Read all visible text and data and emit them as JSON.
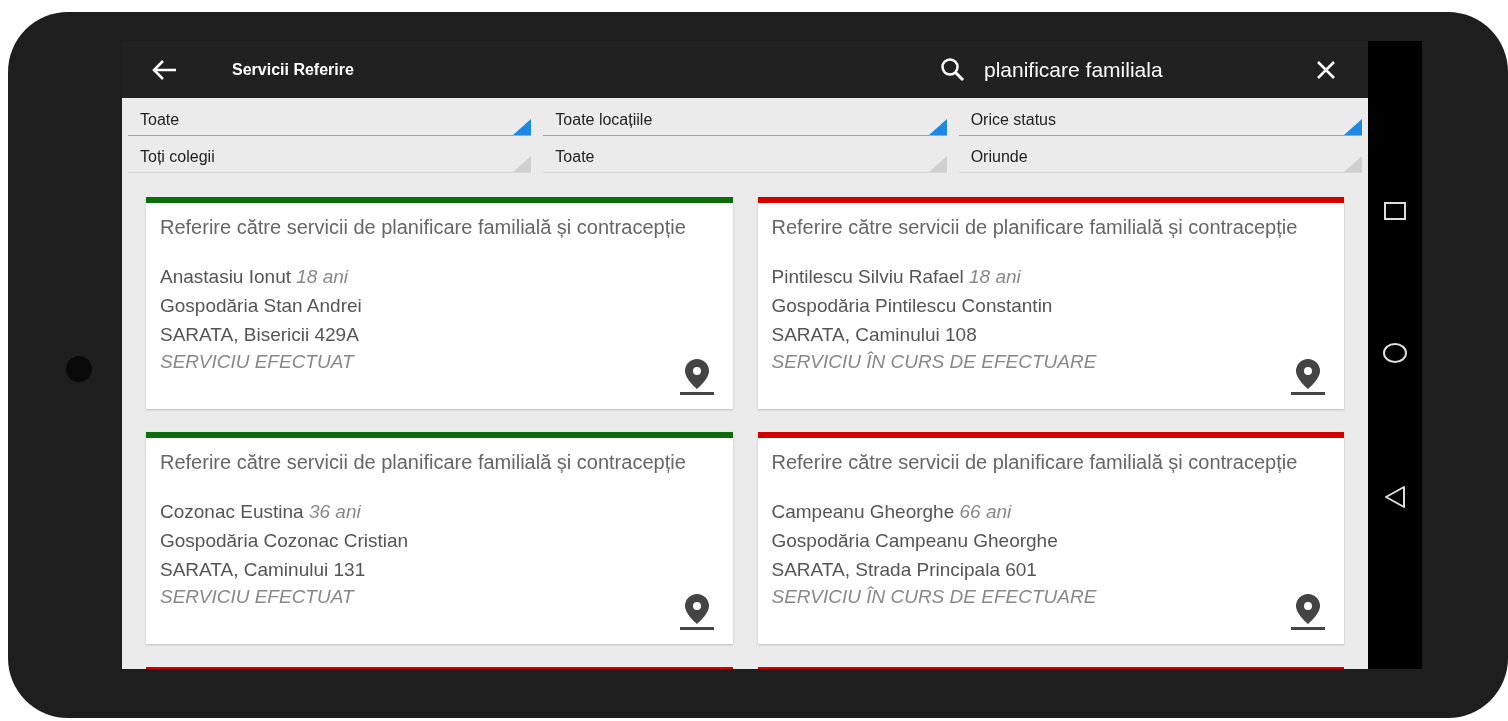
{
  "app_bar": {
    "title": "Servicii Referire",
    "search_value": "planificare familiala"
  },
  "filters": [
    {
      "value": "Toate",
      "highlighted": true
    },
    {
      "value": "Toate locațiile",
      "highlighted": true
    },
    {
      "value": "Orice status",
      "highlighted": true
    },
    {
      "value": "Toți colegii",
      "highlighted": false
    },
    {
      "value": "Toate",
      "highlighted": false
    },
    {
      "value": "Oriunde",
      "highlighted": false
    }
  ],
  "cards": [
    {
      "color": "#0b6e0b",
      "title": "Referire către servicii de planificare familială și contracepție",
      "name": "Anastasiu Ionut",
      "age": "18 ani",
      "household": "Gospodăria Stan Andrei",
      "address": "SARATA, Bisericii 429A",
      "status": "SERVICIU EFECTUAT"
    },
    {
      "color": "#d40000",
      "title": "Referire către servicii de planificare familială și contracepție",
      "name": "Pintilescu Silviu Rafael",
      "age": "18 ani",
      "household": "Gospodăria Pintilescu Constantin",
      "address": "SARATA, Caminului 108",
      "status": "SERVICIU ÎN CURS DE EFECTUARE"
    },
    {
      "color": "#0b6e0b",
      "title": "Referire către servicii de planificare familială și contracepție",
      "name": "Cozonac Eustina",
      "age": "36 ani",
      "household": "Gospodăria Cozonac Cristian",
      "address": "SARATA, Caminului 131",
      "status": "SERVICIU EFECTUAT"
    },
    {
      "color": "#d40000",
      "title": "Referire către servicii de planificare familială și contracepție",
      "name": "Campeanu Gheorghe",
      "age": "66 ani",
      "household": "Gospodăria Campeanu Gheorghe",
      "address": "SARATA, Strada Principala 601",
      "status": "SERVICIU ÎN CURS DE EFECTUARE"
    }
  ],
  "partial_cards": [
    {
      "color": "#d40000"
    },
    {
      "color": "#d40000"
    }
  ]
}
